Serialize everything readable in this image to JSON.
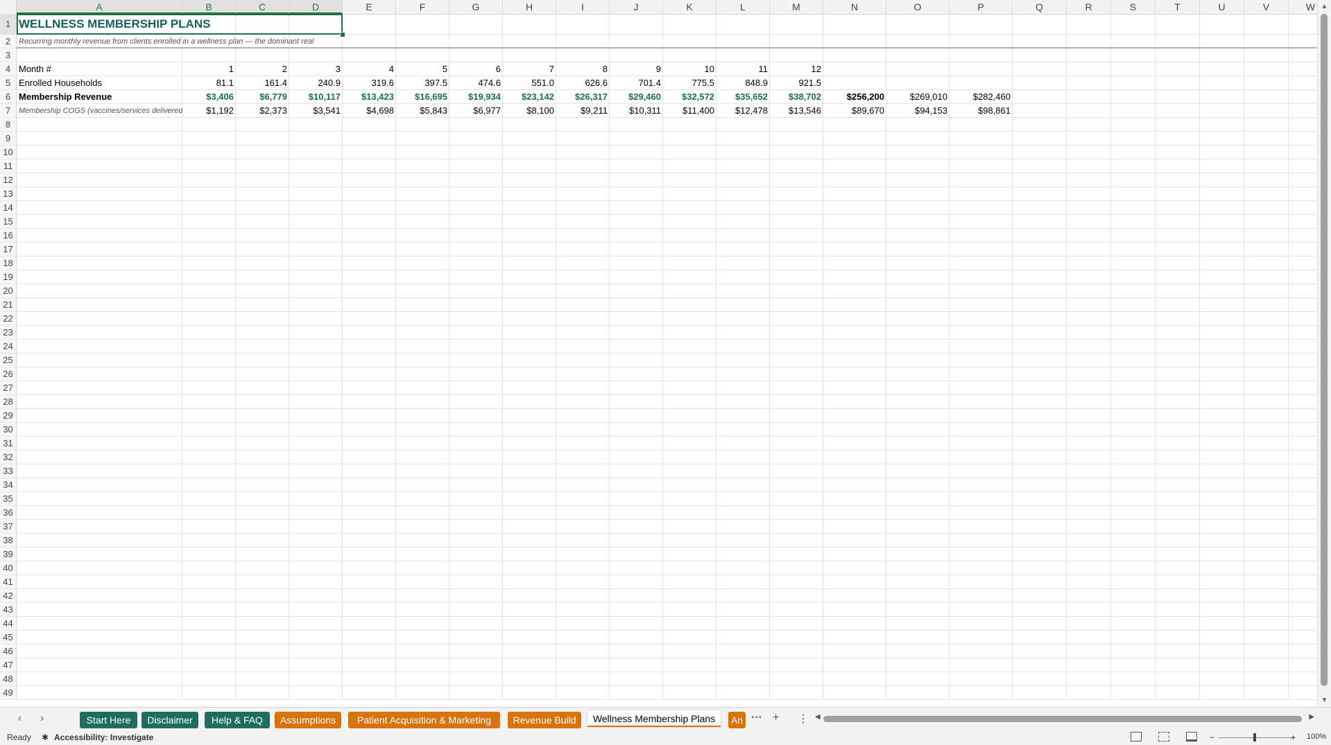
{
  "sheet": {
    "columns": [
      "A",
      "B",
      "C",
      "D",
      "E",
      "F",
      "G",
      "H",
      "I",
      "J",
      "K",
      "L",
      "M",
      "N",
      "O",
      "P",
      "Q",
      "R",
      "S",
      "T",
      "U",
      "V",
      "W"
    ],
    "rows_visible": 49,
    "title": "WELLNESS MEMBERSHIP PLANS",
    "subtitle": "Recurring monthly revenue from clients enrolled in a wellness plan — the dominant real",
    "table": [
      {
        "label": "Month #",
        "values": [
          "1",
          "2",
          "3",
          "4",
          "5",
          "6",
          "7",
          "8",
          "9",
          "10",
          "11",
          "12",
          "",
          "",
          ""
        ]
      },
      {
        "label": "Enrolled Households",
        "values": [
          "81.1",
          "161.4",
          "240.9",
          "319.6",
          "397.5",
          "474.6",
          "551.0",
          "626.6",
          "701.4",
          "775.5",
          "848.9",
          "921.5",
          "",
          "",
          ""
        ]
      },
      {
        "label": "Membership Revenue",
        "values": [
          "$3,406",
          "$6,779",
          "$10,117",
          "$13,423",
          "$16,695",
          "$19,934",
          "$23,142",
          "$26,317",
          "$29,460",
          "$32,572",
          "$35,652",
          "$38,702",
          "$256,200",
          "$269,010",
          "$282,460"
        ]
      },
      {
        "label": "Membership COGS (vaccines/services delivered)",
        "values": [
          "$1,192",
          "$2,373",
          "$3,541",
          "$4,698",
          "$5,843",
          "$6,977",
          "$8,100",
          "$9,211",
          "$10,311",
          "$11,400",
          "$12,478",
          "$13,546",
          "$89,670",
          "$94,153",
          "$98,861"
        ]
      }
    ]
  },
  "tabs": [
    {
      "label": "Start Here",
      "style": "teal"
    },
    {
      "label": "Disclaimer",
      "style": "teal"
    },
    {
      "label": "Help & FAQ",
      "style": "teal"
    },
    {
      "label": "Assumptions",
      "style": "orange"
    },
    {
      "label": "Patient Acquisition & Marketing",
      "style": "orange"
    },
    {
      "label": "Revenue Build",
      "style": "orange"
    },
    {
      "label": "Wellness Membership Plans",
      "style": "active"
    },
    {
      "label": "An",
      "style": "orange"
    }
  ],
  "tab_controls": {
    "more": "···",
    "add": "+",
    "options": "⋮"
  },
  "status": {
    "ready": "Ready",
    "accessibility": "Accessibility: Investigate",
    "zoom": "100%"
  },
  "colors": {
    "teal_tab": "#1d6e61",
    "orange_tab": "#d8730c",
    "title": "#14615a",
    "selection": "#217346"
  }
}
